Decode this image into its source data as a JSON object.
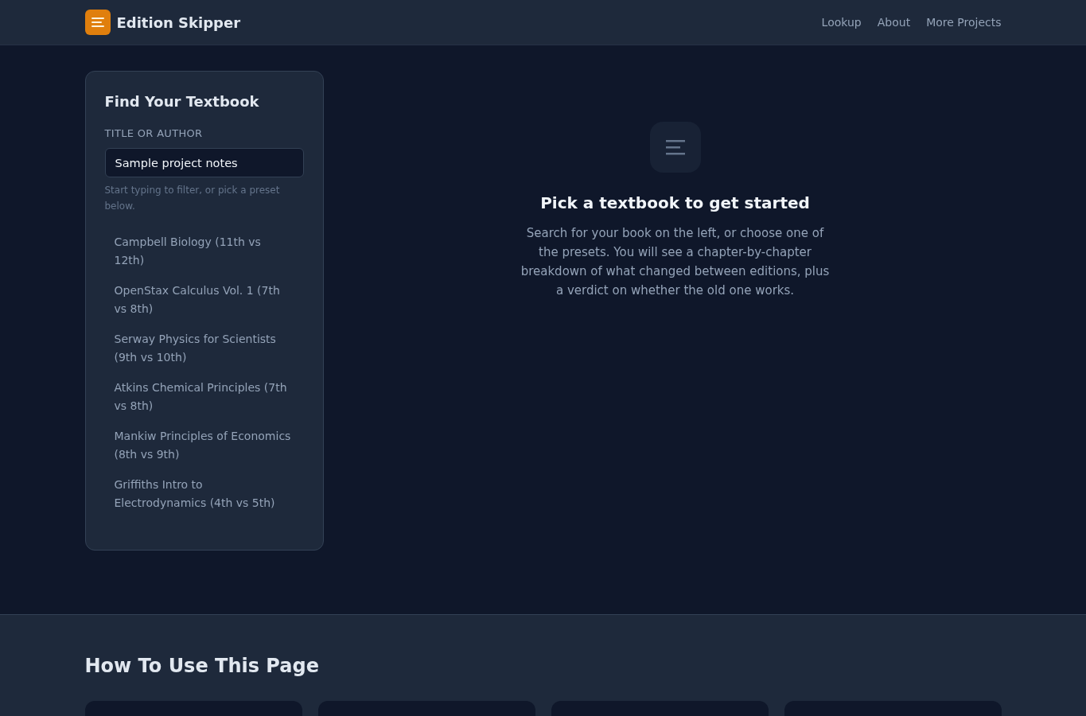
{
  "header": {
    "brand": "Edition Skipper",
    "nav": [
      {
        "label": "Lookup"
      },
      {
        "label": "About"
      },
      {
        "label": "More Projects"
      }
    ]
  },
  "finder": {
    "title": "Find Your Textbook",
    "field_label": "TITLE OR AUTHOR",
    "search": {
      "value": "Sample project notes"
    },
    "hint": "Start typing to filter, or pick a preset below.",
    "presets": [
      {
        "label": "Campbell Biology (11th vs 12th)",
        "selected": false
      },
      {
        "label": "OpenStax Calculus Vol. 1 (7th vs 8th)",
        "selected": false
      },
      {
        "label": "Serway Physics for Scientists (9th vs 10th)",
        "selected": false
      },
      {
        "label": "Atkins Chemical Principles (7th vs 8th)",
        "selected": false
      },
      {
        "label": "Mankiw Principles of Economics (8th vs 9th)",
        "selected": false
      },
      {
        "label": "Griffiths Intro to Electrodynamics (4th vs 5th)",
        "selected": false
      }
    ]
  },
  "empty_state": {
    "title": "Pick a textbook to get started",
    "text": "Search for your book on the left, or choose one of the presets. You will see a chapter-by-chapter breakdown of what changed between editions, plus a verdict on whether the old one works."
  },
  "how_to": {
    "title": "How To Use This Page"
  }
}
